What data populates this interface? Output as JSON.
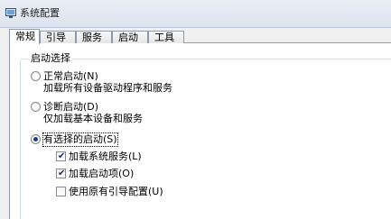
{
  "window": {
    "title": "系统配置",
    "app_icon": "msconfig-app-icon"
  },
  "tabs": [
    {
      "label": "常规",
      "active": true
    },
    {
      "label": "引导",
      "active": false
    },
    {
      "label": "服务",
      "active": false
    },
    {
      "label": "启动",
      "active": false
    },
    {
      "label": "工具",
      "active": false
    }
  ],
  "startup_selection": {
    "group_label": "启动选择",
    "options": [
      {
        "label": "正常启动(N)",
        "description": "加载所有设备驱动程序和服务",
        "checked": false
      },
      {
        "label": "诊断启动(D)",
        "description": "仅加载基本设备和服务",
        "checked": false
      },
      {
        "label": "有选择的启动(S)",
        "checked": true
      }
    ],
    "selective_items": [
      {
        "label": "加载系统服务(L)",
        "checked": true
      },
      {
        "label": "加载启动项(O)",
        "checked": true
      },
      {
        "label": "使用原有引导配置(U)",
        "checked": false
      }
    ]
  },
  "colors": {
    "tab_border": "#8d9aac",
    "titlebar": "#dde4ee",
    "radio_dot": "#1d3c7a"
  }
}
